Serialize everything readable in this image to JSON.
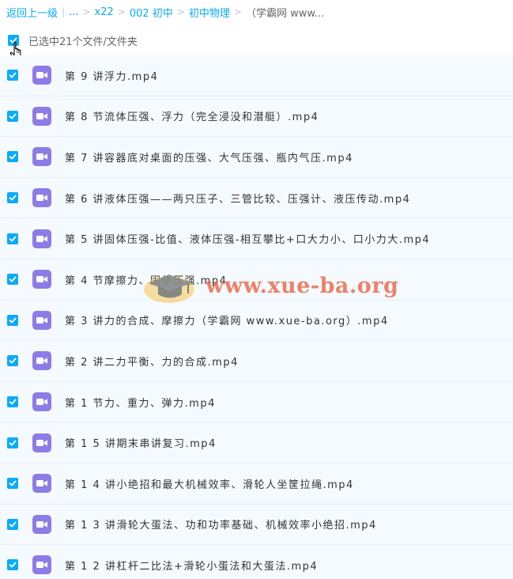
{
  "breadcrumb": {
    "back": "返回上一级",
    "sep": "|",
    "ellipsis": "...",
    "arrow": ">",
    "crumbs": [
      "x22",
      "002 初中",
      "初中物理"
    ],
    "current": "（学霸网 www..."
  },
  "selection": {
    "label": "已选中21个文件/文件夹"
  },
  "files": [
    {
      "name": "第 9 讲浮力.mp4"
    },
    {
      "name": "第 8 节流体压强、浮力（完全浸没和潜艇）.mp4"
    },
    {
      "name": "第 7 讲容器底对桌面的压强、大气压强、瓶内气压.mp4"
    },
    {
      "name": "第 6 讲液体压强——两只压子、三管比较、压强计、液压传动.mp4"
    },
    {
      "name": "第 5 讲固体压强-比值、液体压强-相互攀比+口大力小、口小力大.mp4"
    },
    {
      "name": "第 4 节摩擦力、固体压强.mp4"
    },
    {
      "name": "第 3 讲力的合成、摩擦力（学霸网 www.xue-ba.org）.mp4"
    },
    {
      "name": "第 2 讲二力平衡、力的合成.mp4"
    },
    {
      "name": "第 1 节力、重力、弹力.mp4"
    },
    {
      "name": "第 1 5 讲期末串讲复习.mp4"
    },
    {
      "name": "第 1 4 讲小绝招和最大机械效率、滑轮人坐筐拉绳.mp4"
    },
    {
      "name": "第 1 3 讲滑轮大蛋法、功和功率基础、机械效率小绝招.mp4"
    },
    {
      "name": "第 1 2 讲杠杆二比法+滑轮小蛋法和大蛋法.mp4"
    }
  ],
  "watermark": {
    "text": "www.xue-ba.org",
    "icon": "graduation-cap-logo"
  },
  "colors": {
    "accent": "#09aaff",
    "video_icon": "#8e7ce6",
    "row_bg": "#f5faff",
    "watermark": "#e86040"
  }
}
